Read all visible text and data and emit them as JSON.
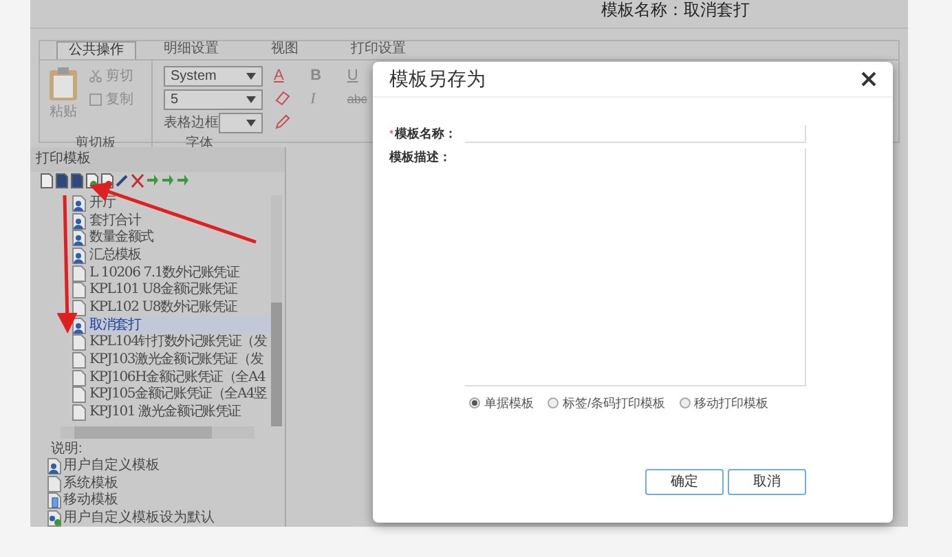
{
  "banner": {
    "text": "模板名称：取消套打"
  },
  "ribbon": {
    "tabs": [
      {
        "label": "公共操作",
        "selected": true
      },
      {
        "label": "明细设置",
        "selected": false
      },
      {
        "label": "视图",
        "selected": false
      },
      {
        "label": "打印设置",
        "selected": false
      }
    ],
    "clipboard": {
      "paste": "粘贴",
      "cut": "剪切",
      "copy": "复制",
      "group": "剪切板"
    },
    "font": {
      "family": "System",
      "size": "5",
      "border_label": "表格边框",
      "group": "字体",
      "format": {
        "font_color": "A",
        "bold": "B",
        "underline": "U",
        "italic": "I",
        "strike": "abc"
      }
    }
  },
  "template_panel": {
    "title": "打印模板",
    "items": [
      {
        "label": "开厅",
        "kind": "user",
        "selected": false
      },
      {
        "label": "套打合计",
        "kind": "user",
        "selected": false
      },
      {
        "label": "数量金额式",
        "kind": "user",
        "selected": false
      },
      {
        "label": "汇总模板",
        "kind": "user",
        "selected": false
      },
      {
        "label": "L 10206 7.1数外记账凭证",
        "kind": "system",
        "selected": false
      },
      {
        "label": "KPL101 U8金额记账凭证",
        "kind": "system",
        "selected": false
      },
      {
        "label": "KPL102 U8数外记账凭证",
        "kind": "system",
        "selected": false
      },
      {
        "label": "取消套打",
        "kind": "user",
        "selected": true
      },
      {
        "label": "KPL104针打数外记账凭证（发",
        "kind": "system",
        "selected": false
      },
      {
        "label": "KPJ103激光金额记账凭证（发",
        "kind": "system",
        "selected": false
      },
      {
        "label": "KPJ106H金额记账凭证（全A4",
        "kind": "system",
        "selected": false
      },
      {
        "label": "KPJ105金额记账凭证（全A4竖",
        "kind": "system",
        "selected": false
      },
      {
        "label": "KPJ101 激光金额记账凭证",
        "kind": "system",
        "selected": false
      }
    ],
    "legend_title": "说明:",
    "legend": [
      {
        "label": "用户自定义模板",
        "kind": "user"
      },
      {
        "label": "系统模板",
        "kind": "system"
      },
      {
        "label": "移动模板",
        "kind": "mobile"
      },
      {
        "label": "用户自定义模板设为默认",
        "kind": "default"
      }
    ]
  },
  "dialog": {
    "title": "模板另存为",
    "required_mark": "*",
    "name_label": "模板名称：",
    "description_label": "模板描述：",
    "types": [
      {
        "label": "单据模板",
        "selected": true
      },
      {
        "label": "标签/条码打印模板",
        "selected": false
      },
      {
        "label": "移动打印模板",
        "selected": false
      }
    ],
    "buttons": [
      "确定",
      "取消"
    ]
  }
}
